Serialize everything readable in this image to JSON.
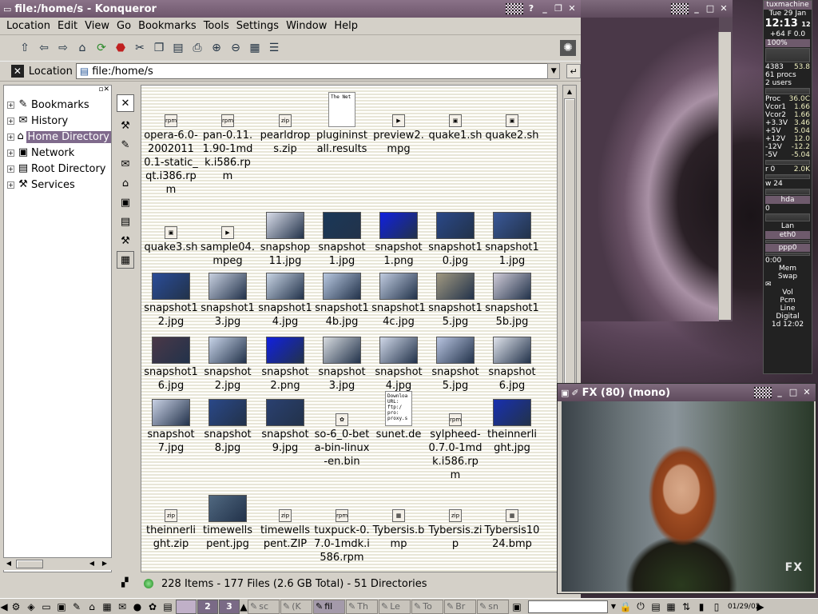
{
  "konqueror": {
    "title": "file:/home/s - Konqueror",
    "menu": [
      "Location",
      "Edit",
      "View",
      "Go",
      "Bookmarks",
      "Tools",
      "Settings",
      "Window",
      "Help"
    ],
    "location_label": "Location",
    "location_value": "file:/home/s",
    "tree": [
      {
        "label": "Bookmarks",
        "icon": "bookmark-icon"
      },
      {
        "label": "History",
        "icon": "history-icon"
      },
      {
        "label": "Home Directory",
        "icon": "home-icon",
        "selected": true
      },
      {
        "label": "Network",
        "icon": "network-icon"
      },
      {
        "label": "Root Directory",
        "icon": "folder-icon"
      },
      {
        "label": "Services",
        "icon": "services-icon"
      }
    ],
    "files": [
      {
        "name": "opera-6.0-20020110.1-static_qt.i386.rpm",
        "icon": "rpm"
      },
      {
        "name": "pan-0.11.1.90-1mdk.i586.rpm",
        "icon": "rpm"
      },
      {
        "name": "pearldrops.zip",
        "icon": "zip"
      },
      {
        "name": "plugininstall.results",
        "icon": "doc",
        "preview": "The Net"
      },
      {
        "name": "preview2.mpg",
        "icon": "mpg"
      },
      {
        "name": "quake1.sh",
        "icon": "sh"
      },
      {
        "name": "quake2.sh",
        "icon": "sh"
      },
      {
        "name": "quake3.sh",
        "icon": "sh"
      },
      {
        "name": "sample04.mpeg",
        "icon": "mpg"
      },
      {
        "name": "snapshop11.jpg",
        "icon": "thumb",
        "color": "#d8dce8"
      },
      {
        "name": "snapshot1.jpg",
        "icon": "thumb",
        "color": "#1a3858"
      },
      {
        "name": "snapshot1.png",
        "icon": "thumb",
        "color": "#1020e0"
      },
      {
        "name": "snapshot10.jpg",
        "icon": "thumb",
        "color": "#2a4888"
      },
      {
        "name": "snapshot11.jpg",
        "icon": "thumb",
        "color": "#3a5898"
      },
      {
        "name": "snapshot12.jpg",
        "icon": "thumb",
        "color": "#2a4c98"
      },
      {
        "name": "snapshot13.jpg",
        "icon": "thumb",
        "color": "#c8d0e0"
      },
      {
        "name": "snapshot14.jpg",
        "icon": "thumb",
        "color": "#c8d4e4"
      },
      {
        "name": "snapshot14b.jpg",
        "icon": "thumb",
        "color": "#b8c8e0"
      },
      {
        "name": "snapshot14c.jpg",
        "icon": "thumb",
        "color": "#c0cce0"
      },
      {
        "name": "snapshot15.jpg",
        "icon": "thumb",
        "color": "#a09880"
      },
      {
        "name": "snapshot15b.jpg",
        "icon": "thumb",
        "color": "#d0ccd8"
      },
      {
        "name": "snapshot16.jpg",
        "icon": "thumb",
        "color": "#4a3848"
      },
      {
        "name": "snapshot2.jpg",
        "icon": "thumb",
        "color": "#c8d4e8"
      },
      {
        "name": "snapshot2.png",
        "icon": "thumb",
        "color": "#1020e0"
      },
      {
        "name": "snapshot3.jpg",
        "icon": "thumb",
        "color": "#d8dce0"
      },
      {
        "name": "snapshot4.jpg",
        "icon": "thumb",
        "color": "#d0d8e8"
      },
      {
        "name": "snapshot5.jpg",
        "icon": "thumb",
        "color": "#b8c4e0"
      },
      {
        "name": "snapshot6.jpg",
        "icon": "thumb",
        "color": "#e0e4ec"
      },
      {
        "name": "snapshot7.jpg",
        "icon": "thumb",
        "color": "#c8d0e4"
      },
      {
        "name": "snapshot8.jpg",
        "icon": "thumb",
        "color": "#2a4888"
      },
      {
        "name": "snapshot9.jpg",
        "icon": "thumb",
        "color": "#2a4070"
      },
      {
        "name": "so-6_0-beta-bin-linux-en.bin",
        "icon": "bin"
      },
      {
        "name": "sunet.de",
        "icon": "doc",
        "preview": "Downloa URL: ftp:/ pro: proxy.s"
      },
      {
        "name": "sylpheed-0.7.0-1mdk.i586.rpm",
        "icon": "rpm"
      },
      {
        "name": "theinnerlight.jpg",
        "icon": "thumb",
        "color": "#1830b0"
      },
      {
        "name": "theinnerlight.zip",
        "icon": "zip"
      },
      {
        "name": "timewellspent.jpg",
        "icon": "thumb",
        "color": "#506880"
      },
      {
        "name": "timewellspent.ZIP",
        "icon": "zip"
      },
      {
        "name": "tuxpuck-0.7.0-1mdk.i586.rpm",
        "icon": "rpm"
      },
      {
        "name": "Tybersis.bmp",
        "icon": "bmp"
      },
      {
        "name": "Tybersis.zip",
        "icon": "zip"
      },
      {
        "name": "Tybersis1024.bmp",
        "icon": "bmp"
      }
    ],
    "status": "228 Items - 177 Files (2.6 GB Total) - 51 Directories"
  },
  "tv": {
    "title": "FX (80) (mono)",
    "logo": "FX"
  },
  "monitor": {
    "host": "tuxmachine",
    "date": "Tue 29 Jan",
    "time": "12:13",
    "time_suffix": "12",
    "temp": "+64 F 0.0",
    "percent": "100%",
    "mem1": "4383",
    "mem2": "53.8",
    "procs": "61 procs",
    "users": "2 users",
    "proc_label": "Proc",
    "proc_val": "36.0C",
    "sensors": [
      [
        "Vcor1",
        "1.66"
      ],
      [
        "Vcor2",
        "1.66"
      ],
      [
        "+3.3V",
        "3.46"
      ],
      [
        "+5V",
        "5.04"
      ],
      [
        "+12V",
        "12.0"
      ],
      [
        "-12V",
        "-12.2"
      ],
      [
        "-5V",
        "-5.04"
      ]
    ],
    "r0": "r 0",
    "r0v": "2.0K",
    "w24": "w 24",
    "hda": "hda",
    "lan": "Lan",
    "eth0": "eth0",
    "ppp0": "ppp0",
    "uptime1": "0:00",
    "mem_label": "Mem",
    "swap_label": "Swap",
    "vol": "Vol",
    "pcm": "Pcm",
    "line": "Line",
    "digital": "Digital",
    "uptime2": "1d 12:02"
  },
  "taskbar": {
    "pagers": [
      "2",
      "3"
    ],
    "tasks": [
      "sc",
      "(K",
      "fil",
      "Th",
      "Le",
      "To",
      "Br",
      "sn"
    ],
    "date": "01/29/02"
  }
}
